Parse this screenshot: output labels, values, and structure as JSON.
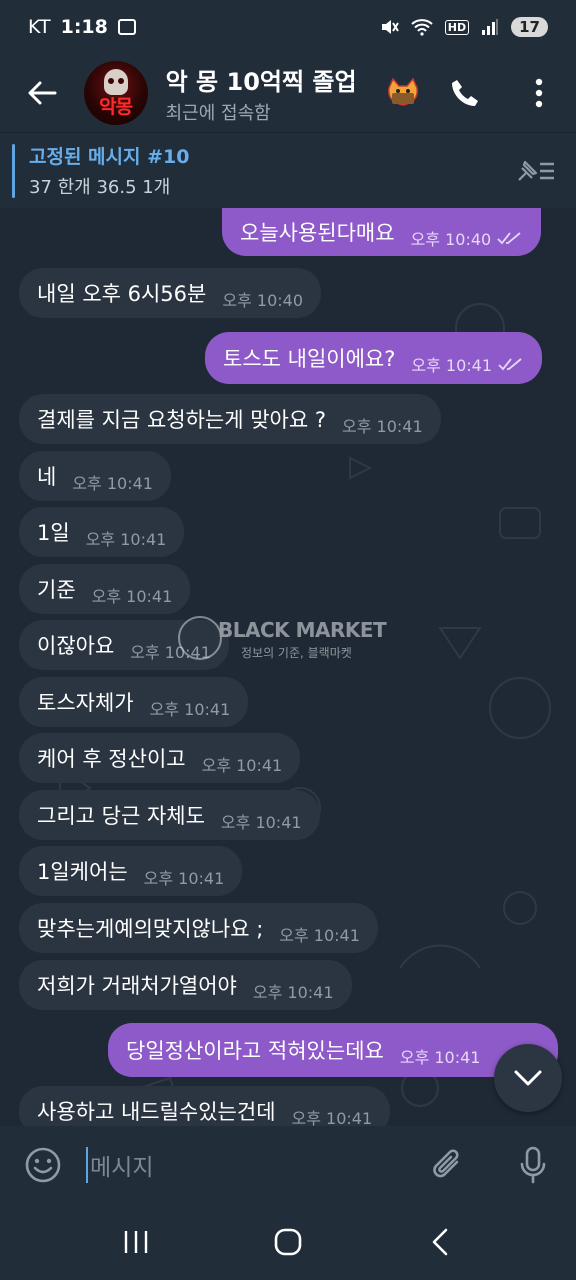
{
  "status_bar": {
    "carrier": "KT",
    "time": "1:18",
    "hd_label": "HD",
    "battery": "17"
  },
  "header": {
    "avatar_text": "악몽",
    "title": "악 몽 10억찍 졸업",
    "subtitle": "최근에 접속함"
  },
  "pinned": {
    "title": "고정된 메시지 #10",
    "body": "37 한개 36.5 1개"
  },
  "watermark": {
    "title": "BLACK MARKET",
    "subtitle": "정보의 기준, 블랙마켓"
  },
  "messages": [
    {
      "dir": "out",
      "text": "오늘사용된다매요",
      "time": "오후 10:40",
      "read": true
    },
    {
      "dir": "in",
      "text": "내일 오후 6시56분",
      "time": "오후 10:40"
    },
    {
      "dir": "out",
      "text": "토스도 내일이에요?",
      "time": "오후 10:41",
      "read": true
    },
    {
      "dir": "in",
      "text": "결제를 지금 요청하는게 맞아요 ?",
      "time": "오후 10:41"
    },
    {
      "dir": "in",
      "text": "네",
      "time": "오후 10:41"
    },
    {
      "dir": "in",
      "text": "1일",
      "time": "오후 10:41"
    },
    {
      "dir": "in",
      "text": "기준",
      "time": "오후 10:41"
    },
    {
      "dir": "in",
      "text": "이잖아요",
      "time": "오후 10:41"
    },
    {
      "dir": "in",
      "text": "토스자체가",
      "time": "오후 10:41"
    },
    {
      "dir": "in",
      "text": "케어 후 정산이고",
      "time": "오후 10:41"
    },
    {
      "dir": "in",
      "text": "그리고 당근 자체도",
      "time": "오후 10:41"
    },
    {
      "dir": "in",
      "text": "1일케어는",
      "time": "오후 10:41"
    },
    {
      "dir": "in",
      "text": "맞추는게예의맞지않나요 ;",
      "time": "오후 10:41"
    },
    {
      "dir": "in",
      "text": "저희가 거래처가열어야",
      "time": "오후 10:41"
    },
    {
      "dir": "out",
      "text": "당일정산이라고 적혀있는데요",
      "time": "오후 10:41",
      "read": true
    },
    {
      "dir": "in",
      "text": "사용하고 내드릴수있는건데",
      "time": "오후 10:41"
    }
  ],
  "input": {
    "placeholder": "메시지"
  },
  "colors": {
    "outgoing_bubble": "#8e5ac9",
    "incoming_bubble": "#2b3541",
    "header_bg": "#222d3a",
    "accent": "#66aeec"
  },
  "icons": {
    "back": "arrow-left-icon",
    "call": "phone-icon",
    "menu": "more-vertical-icon",
    "pin_list": "pin-list-icon",
    "scroll": "chevron-down-icon",
    "emoji": "emoji-icon",
    "attach": "paperclip-icon",
    "mic": "microphone-icon"
  }
}
